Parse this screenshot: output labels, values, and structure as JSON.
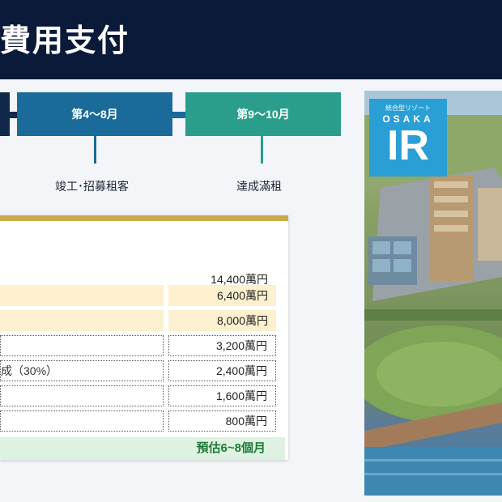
{
  "header": {
    "title": "費用支付"
  },
  "timeline": {
    "phases": [
      {
        "label": "第4～8月",
        "color": "#1a6a9a"
      },
      {
        "label": "第9～10月",
        "color": "#2a9e8a"
      }
    ],
    "milestones": [
      "竣工･招募租客",
      "達成滿租"
    ]
  },
  "costs": {
    "rows": [
      {
        "label": "",
        "value": "14,400萬円"
      },
      {
        "label": "",
        "value": "6,400萬円"
      },
      {
        "label": "",
        "value": "8,000萬円"
      },
      {
        "label": "",
        "value": "3,200萬円"
      },
      {
        "label": "成（30%）",
        "value": "2,400萬円"
      },
      {
        "label": "",
        "value": "1,600萬円"
      },
      {
        "label": "",
        "value": "800萬円"
      }
    ],
    "footer": "預估6~8個月",
    "accent_color": "#c8aa48"
  },
  "image": {
    "logo_sub": "統合型リゾート",
    "logo_osaka": "OSAKA",
    "logo_ir": "IR"
  }
}
